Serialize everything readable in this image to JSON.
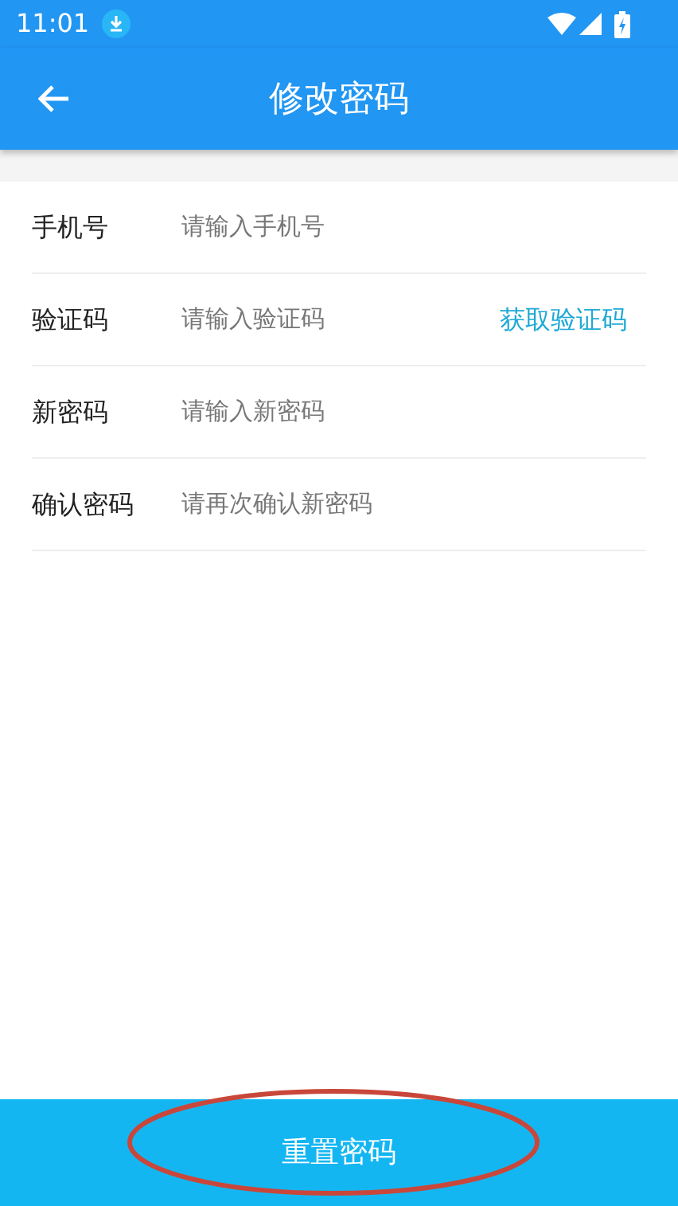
{
  "status_bar": {
    "time": "11:01"
  },
  "app_bar": {
    "title": "修改密码"
  },
  "form": {
    "rows": [
      {
        "label": "手机号",
        "placeholder": "请输入手机号"
      },
      {
        "label": "验证码",
        "placeholder": "请输入验证码",
        "action": "获取验证码"
      },
      {
        "label": "新密码",
        "placeholder": "请输入新密码"
      },
      {
        "label": "确认密码",
        "placeholder": "请再次确认新密码"
      }
    ]
  },
  "submit_button": {
    "label": "重置密码"
  }
}
